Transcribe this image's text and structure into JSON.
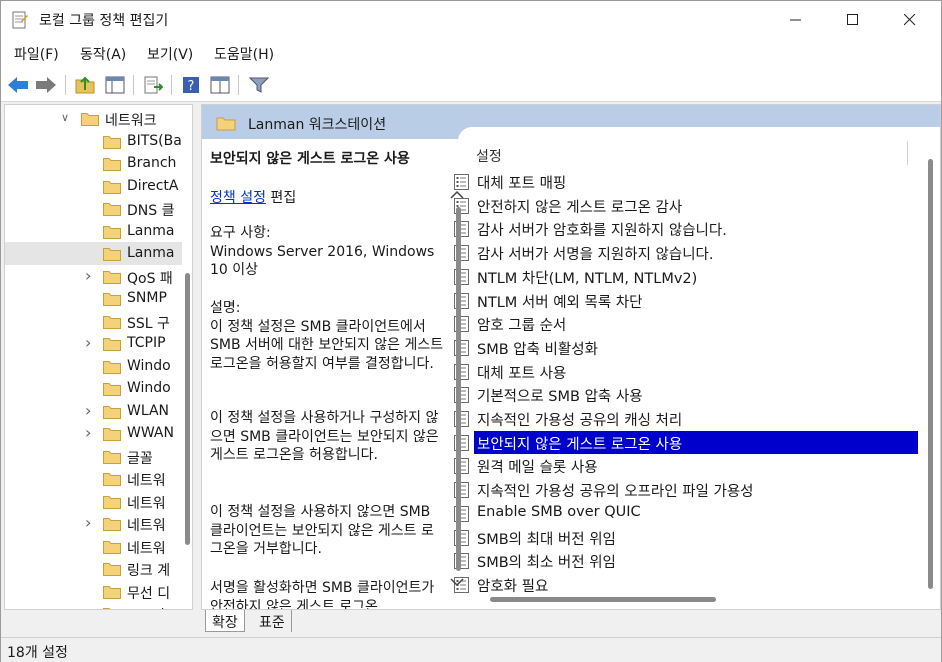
{
  "window": {
    "title": "로컬 그룹 정책 편집기"
  },
  "menu": [
    "파일(F)",
    "동작(A)",
    "보기(V)",
    "도움말(H)"
  ],
  "toolbar": {
    "buttons": [
      "back-icon",
      "forward-icon",
      "up-folder-icon",
      "show-hide-tree-icon",
      "export-list-icon",
      "help-icon",
      "properties-view-icon",
      "filter-icon"
    ]
  },
  "tree": {
    "items": [
      {
        "label": "네트워크",
        "expander": "v"
      },
      {
        "label": "BITS(Ba",
        "expander": ""
      },
      {
        "label": "Branch",
        "expander": ""
      },
      {
        "label": "DirectA",
        "expander": ""
      },
      {
        "label": "DNS 클",
        "expander": ""
      },
      {
        "label": "Lanma",
        "expander": ""
      },
      {
        "label": "Lanma",
        "expander": "",
        "selected": true
      },
      {
        "label": "QoS 패",
        "expander": ">"
      },
      {
        "label": "SNMP",
        "expander": ""
      },
      {
        "label": "SSL 구",
        "expander": ""
      },
      {
        "label": "TCPIP",
        "expander": ">"
      },
      {
        "label": "Windo",
        "expander": ""
      },
      {
        "label": "Windo",
        "expander": ""
      },
      {
        "label": "WLAN",
        "expander": ">"
      },
      {
        "label": "WWAN",
        "expander": ">"
      },
      {
        "label": "글꼴",
        "expander": ""
      },
      {
        "label": "네트워",
        "expander": ""
      },
      {
        "label": "네트워",
        "expander": ""
      },
      {
        "label": "네트워",
        "expander": ">"
      },
      {
        "label": "네트워",
        "expander": ""
      },
      {
        "label": "링크 계",
        "expander": ""
      },
      {
        "label": "무선 디",
        "expander": ""
      },
      {
        "label": "오프라",
        "expander": ""
      }
    ]
  },
  "panel": {
    "header": "Lanman 워크스테이션",
    "desc": {
      "title": "보안되지 않은 게스트 로그온 사용",
      "edit_link": "정책 설정",
      "edit_suffix": " 편집",
      "requirements": "요구 사항:\nWindows Server 2016, Windows 10 이상",
      "desc_label": "설명:\n이 정책 설정은 SMB 클라이언트에서 SMB 서버에 대한 보안되지 않은 게스트 로그온을 허용할지 여부를 결정합니다.",
      "para2": "이 정책 설정을 사용하거나 구성하지 않으면 SMB 클라이언트는 보안되지 않은 게스트 로그온을 허용합니다.",
      "para3": "이 정책 설정을 사용하지 않으면 SMB 클라이언트는 보안되지 않은 게스트 로그온을 거부합니다.",
      "para4": "서명을 활성화하면 SMB 클라이언트가 안전하지 않은 게스트 로그온"
    },
    "list_header": "설정",
    "settings": [
      "대체 포트 매핑",
      "안전하지 않은 게스트 로그온 감사",
      "감사 서버가 암호화를 지원하지 않습니다.",
      "감사 서버가 서명을 지원하지 않습니다.",
      "NTLM 차단(LM, NTLM, NTLMv2)",
      "NTLM 서버 예외 목록 차단",
      "암호 그룹 순서",
      "SMB 압축 비활성화",
      "대체 포트 사용",
      "기본적으로 SMB 압축 사용",
      "지속적인 가용성 공유의 캐싱 처리",
      "보안되지 않은 게스트 로그온 사용",
      "원격 메일 슬롯 사용",
      "지속적인 가용성 공유의 오프라인 파일 가용성",
      "Enable SMB over QUIC",
      "SMB의 최대 버전 위임",
      "SMB의 최소 버전 위임",
      "암호화 필요"
    ],
    "selected_index": 11
  },
  "tabs": [
    "확장",
    "표준"
  ],
  "status": "18개 설정",
  "colors": {
    "selection": "#0000cc",
    "header_band": "#b9cde6",
    "link": "#0033cc"
  }
}
